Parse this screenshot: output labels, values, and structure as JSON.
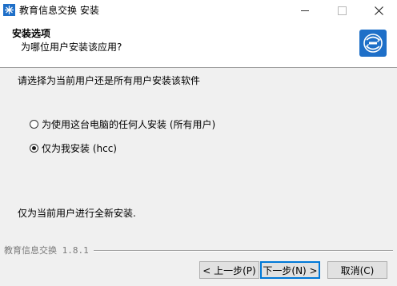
{
  "window": {
    "title": "教育信息交换 安装"
  },
  "header": {
    "title": "安装选项",
    "subtitle": "为哪位用户安装该应用?"
  },
  "body": {
    "prompt": "请选择为当前用户还是所有用户安装该软件",
    "options": [
      {
        "label": "为使用这台电脑的任何人安装 (所有用户)",
        "selected": false
      },
      {
        "label": "仅为我安装 (hcc)",
        "selected": true
      }
    ],
    "description": "仅为当前用户进行全新安装."
  },
  "footer": {
    "brand": "教育信息交换 1.8.1",
    "back_label": "< 上一步(P)",
    "next_label": "下一步(N) >",
    "cancel_label": "取消(C)"
  },
  "colors": {
    "accent": "#0078d7",
    "logo_blue": "#1e6fc8"
  }
}
